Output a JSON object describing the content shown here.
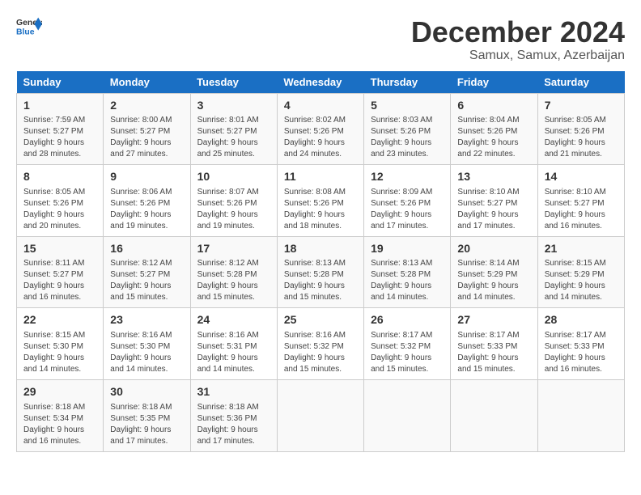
{
  "logo": {
    "line1": "General",
    "line2": "Blue"
  },
  "title": "December 2024",
  "subtitle": "Samux, Samux, Azerbaijan",
  "days_header": [
    "Sunday",
    "Monday",
    "Tuesday",
    "Wednesday",
    "Thursday",
    "Friday",
    "Saturday"
  ],
  "weeks": [
    [
      {
        "day": "1",
        "info": "Sunrise: 7:59 AM\nSunset: 5:27 PM\nDaylight: 9 hours\nand 28 minutes."
      },
      {
        "day": "2",
        "info": "Sunrise: 8:00 AM\nSunset: 5:27 PM\nDaylight: 9 hours\nand 27 minutes."
      },
      {
        "day": "3",
        "info": "Sunrise: 8:01 AM\nSunset: 5:27 PM\nDaylight: 9 hours\nand 25 minutes."
      },
      {
        "day": "4",
        "info": "Sunrise: 8:02 AM\nSunset: 5:26 PM\nDaylight: 9 hours\nand 24 minutes."
      },
      {
        "day": "5",
        "info": "Sunrise: 8:03 AM\nSunset: 5:26 PM\nDaylight: 9 hours\nand 23 minutes."
      },
      {
        "day": "6",
        "info": "Sunrise: 8:04 AM\nSunset: 5:26 PM\nDaylight: 9 hours\nand 22 minutes."
      },
      {
        "day": "7",
        "info": "Sunrise: 8:05 AM\nSunset: 5:26 PM\nDaylight: 9 hours\nand 21 minutes."
      }
    ],
    [
      {
        "day": "8",
        "info": "Sunrise: 8:05 AM\nSunset: 5:26 PM\nDaylight: 9 hours\nand 20 minutes."
      },
      {
        "day": "9",
        "info": "Sunrise: 8:06 AM\nSunset: 5:26 PM\nDaylight: 9 hours\nand 19 minutes."
      },
      {
        "day": "10",
        "info": "Sunrise: 8:07 AM\nSunset: 5:26 PM\nDaylight: 9 hours\nand 19 minutes."
      },
      {
        "day": "11",
        "info": "Sunrise: 8:08 AM\nSunset: 5:26 PM\nDaylight: 9 hours\nand 18 minutes."
      },
      {
        "day": "12",
        "info": "Sunrise: 8:09 AM\nSunset: 5:26 PM\nDaylight: 9 hours\nand 17 minutes."
      },
      {
        "day": "13",
        "info": "Sunrise: 8:10 AM\nSunset: 5:27 PM\nDaylight: 9 hours\nand 17 minutes."
      },
      {
        "day": "14",
        "info": "Sunrise: 8:10 AM\nSunset: 5:27 PM\nDaylight: 9 hours\nand 16 minutes."
      }
    ],
    [
      {
        "day": "15",
        "info": "Sunrise: 8:11 AM\nSunset: 5:27 PM\nDaylight: 9 hours\nand 16 minutes."
      },
      {
        "day": "16",
        "info": "Sunrise: 8:12 AM\nSunset: 5:27 PM\nDaylight: 9 hours\nand 15 minutes."
      },
      {
        "day": "17",
        "info": "Sunrise: 8:12 AM\nSunset: 5:28 PM\nDaylight: 9 hours\nand 15 minutes."
      },
      {
        "day": "18",
        "info": "Sunrise: 8:13 AM\nSunset: 5:28 PM\nDaylight: 9 hours\nand 15 minutes."
      },
      {
        "day": "19",
        "info": "Sunrise: 8:13 AM\nSunset: 5:28 PM\nDaylight: 9 hours\nand 14 minutes."
      },
      {
        "day": "20",
        "info": "Sunrise: 8:14 AM\nSunset: 5:29 PM\nDaylight: 9 hours\nand 14 minutes."
      },
      {
        "day": "21",
        "info": "Sunrise: 8:15 AM\nSunset: 5:29 PM\nDaylight: 9 hours\nand 14 minutes."
      }
    ],
    [
      {
        "day": "22",
        "info": "Sunrise: 8:15 AM\nSunset: 5:30 PM\nDaylight: 9 hours\nand 14 minutes."
      },
      {
        "day": "23",
        "info": "Sunrise: 8:16 AM\nSunset: 5:30 PM\nDaylight: 9 hours\nand 14 minutes."
      },
      {
        "day": "24",
        "info": "Sunrise: 8:16 AM\nSunset: 5:31 PM\nDaylight: 9 hours\nand 14 minutes."
      },
      {
        "day": "25",
        "info": "Sunrise: 8:16 AM\nSunset: 5:32 PM\nDaylight: 9 hours\nand 15 minutes."
      },
      {
        "day": "26",
        "info": "Sunrise: 8:17 AM\nSunset: 5:32 PM\nDaylight: 9 hours\nand 15 minutes."
      },
      {
        "day": "27",
        "info": "Sunrise: 8:17 AM\nSunset: 5:33 PM\nDaylight: 9 hours\nand 15 minutes."
      },
      {
        "day": "28",
        "info": "Sunrise: 8:17 AM\nSunset: 5:33 PM\nDaylight: 9 hours\nand 16 minutes."
      }
    ],
    [
      {
        "day": "29",
        "info": "Sunrise: 8:18 AM\nSunset: 5:34 PM\nDaylight: 9 hours\nand 16 minutes."
      },
      {
        "day": "30",
        "info": "Sunrise: 8:18 AM\nSunset: 5:35 PM\nDaylight: 9 hours\nand 17 minutes."
      },
      {
        "day": "31",
        "info": "Sunrise: 8:18 AM\nSunset: 5:36 PM\nDaylight: 9 hours\nand 17 minutes."
      },
      null,
      null,
      null,
      null
    ]
  ]
}
